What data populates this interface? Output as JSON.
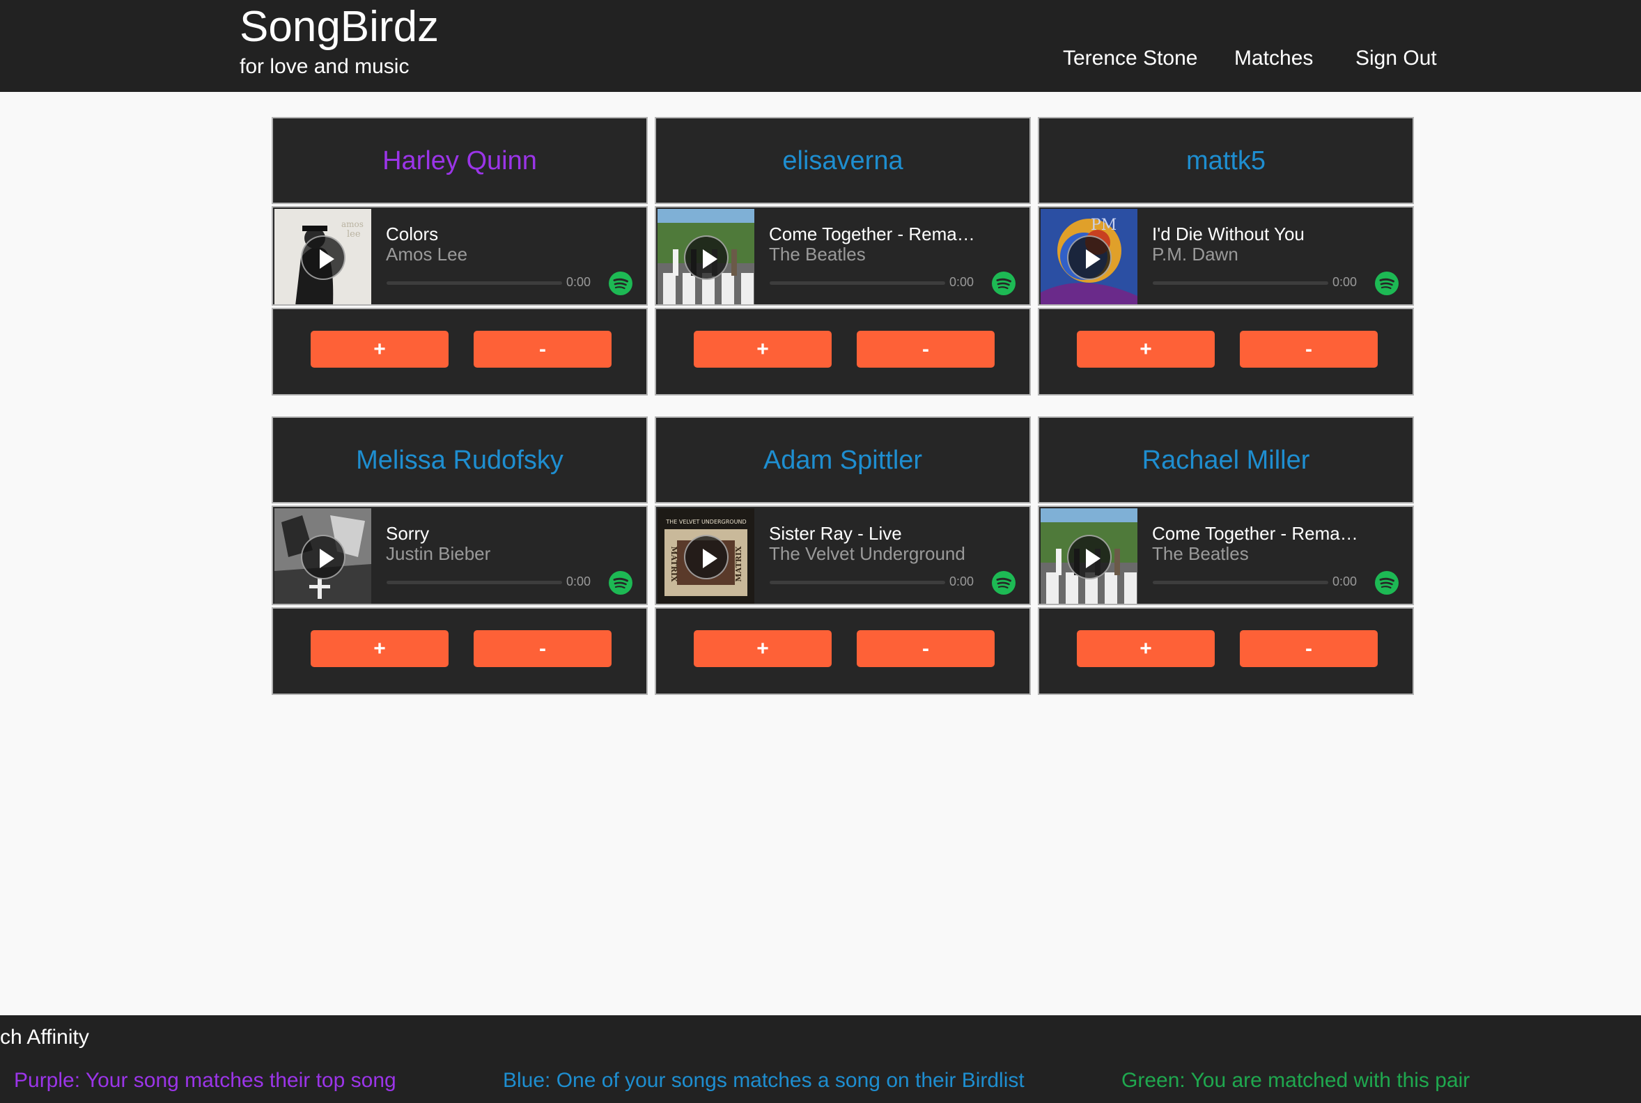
{
  "header": {
    "title": "SongBirdz",
    "tagline": "for love and music",
    "nav": {
      "user": "Terence Stone",
      "matches": "Matches",
      "sign_out": "Sign Out"
    }
  },
  "colors": {
    "purple": "#9b35e8",
    "blue": "#1e8ed0",
    "green": "#1fa84f",
    "button": "#fe6137",
    "spotify": "#1db954"
  },
  "cards": [
    {
      "name": "Harley Quinn",
      "name_color": "#9b35e8",
      "track": "Colors",
      "artist": "Amos Lee",
      "time": "0:00",
      "progress": 0,
      "plus": "+",
      "minus": "-",
      "album_icon": "album-art-colors"
    },
    {
      "name": "elisaverna",
      "name_color": "#1e8ed0",
      "track": "Come Together - Remast...",
      "artist": "The Beatles",
      "time": "0:00",
      "progress": 0,
      "plus": "+",
      "minus": "-",
      "album_icon": "album-art-abbey-road"
    },
    {
      "name": "mattk5",
      "name_color": "#1e8ed0",
      "track": "I'd Die Without You",
      "artist": "P.M. Dawn",
      "time": "0:00",
      "progress": 0,
      "plus": "+",
      "minus": "-",
      "album_icon": "album-art-pm-dawn"
    },
    {
      "name": "Melissa Rudofsky",
      "name_color": "#1e8ed0",
      "track": "Sorry",
      "artist": "Justin Bieber",
      "time": "0:00",
      "progress": 0,
      "plus": "+",
      "minus": "-",
      "album_icon": "album-art-purpose"
    },
    {
      "name": "Adam Spittler",
      "name_color": "#1e8ed0",
      "track": "Sister Ray - Live",
      "artist": "The Velvet Underground",
      "time": "0:00",
      "progress": 0,
      "plus": "+",
      "minus": "-",
      "album_icon": "album-art-matrix"
    },
    {
      "name": "Rachael Miller",
      "name_color": "#1e8ed0",
      "track": "Come Together - Remast...",
      "artist": "The Beatles",
      "time": "0:00",
      "progress": 0,
      "plus": "+",
      "minus": "-",
      "album_icon": "album-art-abbey-road"
    }
  ],
  "footer": {
    "heading": "ch Affinity",
    "legend": {
      "purple": "Purple: Your song matches their top song",
      "blue": "Blue: One of your songs matches a song on their Birdlist",
      "green": "Green: You are matched with this pair"
    }
  }
}
